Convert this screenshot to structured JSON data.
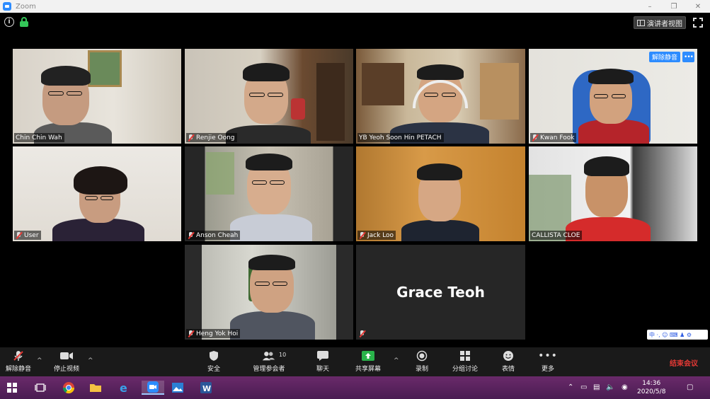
{
  "window": {
    "title": "Zoom",
    "minimize": "–",
    "maximize": "❐",
    "close": "✕"
  },
  "top": {
    "speaker_view_label": "演讲者视图"
  },
  "participants": [
    {
      "name": "Chin Chin Wah",
      "muted": false
    },
    {
      "name": "Renjie Oong",
      "muted": true
    },
    {
      "name": "YB Yeoh Soon Hin PETACH",
      "muted": false,
      "active_speaker": true
    },
    {
      "name": "Kwan Fook",
      "muted": true,
      "unmute_label": "解除静音",
      "more_label": "•••"
    },
    {
      "name": "User",
      "muted": true
    },
    {
      "name": "Anson Cheah",
      "muted": true
    },
    {
      "name": "Jack Loo",
      "muted": true
    },
    {
      "name": "CALLISTA CLOE",
      "muted": true
    },
    {
      "name": "Heng Yok Hoi",
      "muted": true
    },
    {
      "name": "Grace Teoh",
      "muted": true,
      "video_off": true
    }
  ],
  "ime": {
    "label": "中 ·, ☺ ⌨ ♟ ⚙"
  },
  "toolbar": {
    "unmute": "解除静音",
    "stop_video": "停止视频",
    "security": "安全",
    "participants": "管理参会者",
    "participant_count": "10",
    "chat": "聊天",
    "share_screen": "共享屏幕",
    "record": "录制",
    "breakout": "分组讨论",
    "reactions": "表情",
    "more": "更多",
    "end_meeting": "结束会议",
    "caret": "^"
  },
  "taskbar": {
    "time": "14:36",
    "date": "2020/5/8"
  },
  "colors": {
    "zoom_blue": "#2d8cff",
    "share_green": "#29b34a",
    "end_red": "#e53935",
    "active_border": "#e4c93a",
    "taskbar": "#5a2260"
  }
}
